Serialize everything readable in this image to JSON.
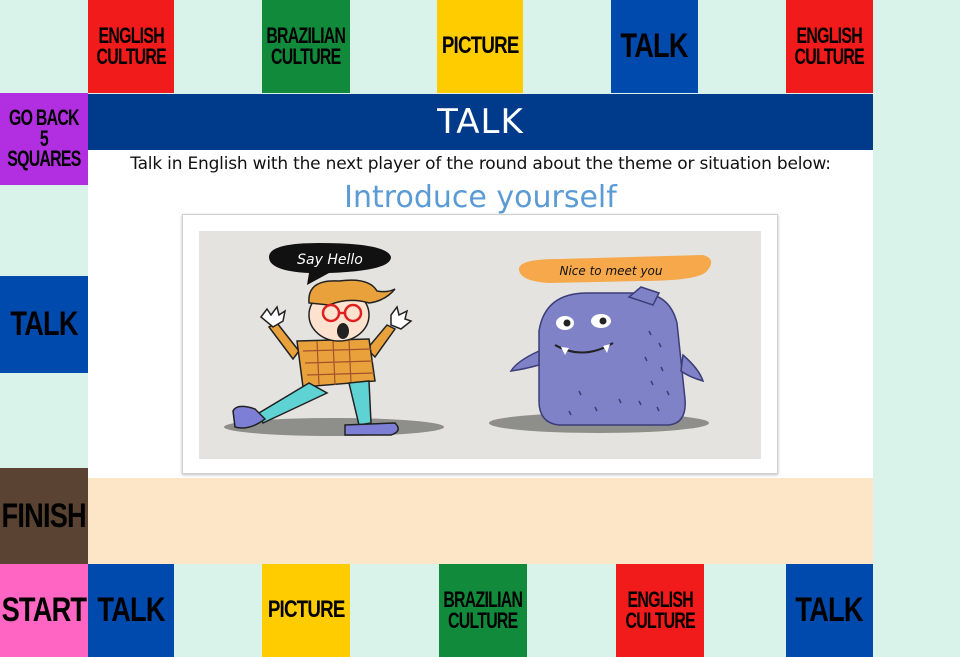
{
  "top_row": [
    {
      "text": "ENGLISH CULTURE",
      "line1": "ENGLISH",
      "line2": "CULTURE",
      "bg": "#f21b1b",
      "fg": "#111111"
    },
    {
      "text": "BRAZILIAN CULTURE",
      "line1": "BRAZILIAN",
      "line2": "CULTURE",
      "bg": "#118a3c",
      "fg": "#111111"
    },
    {
      "text": "PICTURE",
      "bg": "#ffcc00",
      "fg": "#111111"
    },
    {
      "text": "TALK",
      "bg": "#004aad",
      "fg": "#111111"
    },
    {
      "text": "ENGLISH CULTURE",
      "line1": "ENGLISH",
      "line2": "CULTURE",
      "bg": "#f21b1b",
      "fg": "#111111"
    }
  ],
  "left_col": [
    {
      "text": "GO BACK 5 SQUARES",
      "line1": "GO BACK",
      "line2": "5 SQUARES",
      "bg": "#b12fe0",
      "fg": "#111111"
    },
    {
      "text": "TALK",
      "bg": "#004aad",
      "fg": "#111111"
    },
    {
      "text": "FINISH",
      "bg": "#5a4333",
      "fg": "#111111"
    },
    {
      "text": "START",
      "bg": "#ff66c4",
      "fg": "#111111"
    }
  ],
  "bottom_row": [
    {
      "text": "TALK",
      "bg": "#004aad",
      "fg": "#111111"
    },
    {
      "text": "PICTURE",
      "bg": "#ffcc00",
      "fg": "#111111"
    },
    {
      "text": "BRAZILIAN CULTURE",
      "line1": "BRAZILIAN",
      "line2": "CULTURE",
      "bg": "#118a3c",
      "fg": "#111111"
    },
    {
      "text": "ENGLISH CULTURE",
      "line1": "ENGLISH",
      "line2": "CULTURE",
      "bg": "#f21b1b",
      "fg": "#111111"
    },
    {
      "text": "TALK",
      "bg": "#004aad",
      "fg": "#111111"
    }
  ],
  "card": {
    "title": "TALK",
    "instruction": "Talk in English with the next player of the round about the theme or situation below:",
    "theme": "Introduce yourself",
    "bubble_left": "Say Hello",
    "bubble_right": "Nice to meet you"
  },
  "colors": {
    "board_bg": "#d9f2ea",
    "card_header": "#003a8a",
    "theme_text": "#5b9bd5",
    "peach_band": "#fde6c8"
  }
}
